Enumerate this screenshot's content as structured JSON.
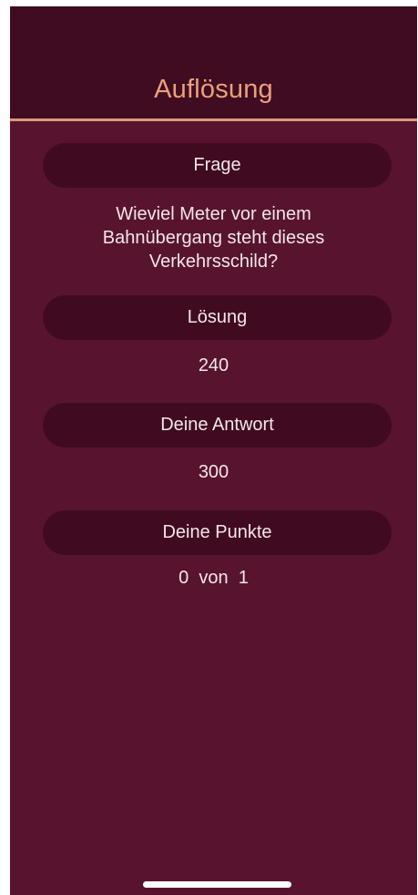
{
  "header": {
    "title": "Auflösung"
  },
  "sections": {
    "question": {
      "label": "Frage",
      "value": "Wieviel Meter vor einem\nBahnübergang steht dieses\nVerkehrsschild?"
    },
    "solution": {
      "label": "Lösung",
      "value": "240"
    },
    "answer": {
      "label": "Deine Antwort",
      "value": "300"
    },
    "points": {
      "label": "Deine Punkte",
      "value": "0  von  1"
    }
  },
  "colors": {
    "background": "#58142e",
    "header_background": "#400c21",
    "pill_background": "#400b20",
    "accent": "#e9a17c",
    "text": "#f2e6ea"
  }
}
